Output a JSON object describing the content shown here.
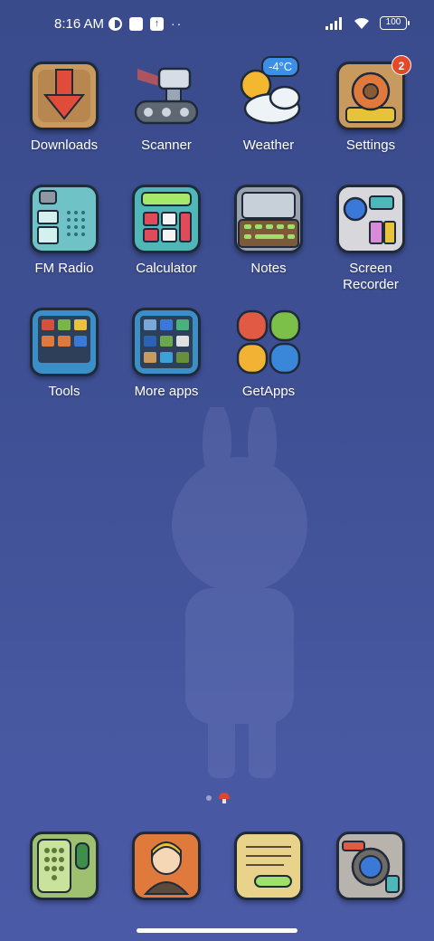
{
  "status_bar": {
    "time": "8:16 AM",
    "battery": "100"
  },
  "home": {
    "apps": [
      {
        "label": "Downloads",
        "icon": "download-arrow-icon"
      },
      {
        "label": "Scanner",
        "icon": "scanner-robot-icon"
      },
      {
        "label": "Weather",
        "icon": "weather-sun-cloud-icon",
        "temp": "-4°C"
      },
      {
        "label": "Settings",
        "icon": "gear-icon",
        "badge": "2"
      },
      {
        "label": "FM Radio",
        "icon": "radio-icon"
      },
      {
        "label": "Calculator",
        "icon": "calculator-icon"
      },
      {
        "label": "Notes",
        "icon": "notes-keyboard-icon"
      },
      {
        "label": "Screen Recorder",
        "icon": "camera-recorder-icon"
      },
      {
        "label": "Tools",
        "icon": "tools-folder-icon"
      },
      {
        "label": "More apps",
        "icon": "more-apps-folder-icon"
      },
      {
        "label": "GetApps",
        "icon": "getapps-petals-icon"
      }
    ]
  },
  "dock": {
    "apps": [
      {
        "icon": "phone-dialer-icon"
      },
      {
        "icon": "contacts-avatar-icon"
      },
      {
        "icon": "messages-scroll-icon"
      },
      {
        "icon": "camera-icon"
      }
    ]
  },
  "colors": {
    "background": "#3e4f93",
    "badge": "#e24a2a",
    "label": "#ffffff"
  }
}
